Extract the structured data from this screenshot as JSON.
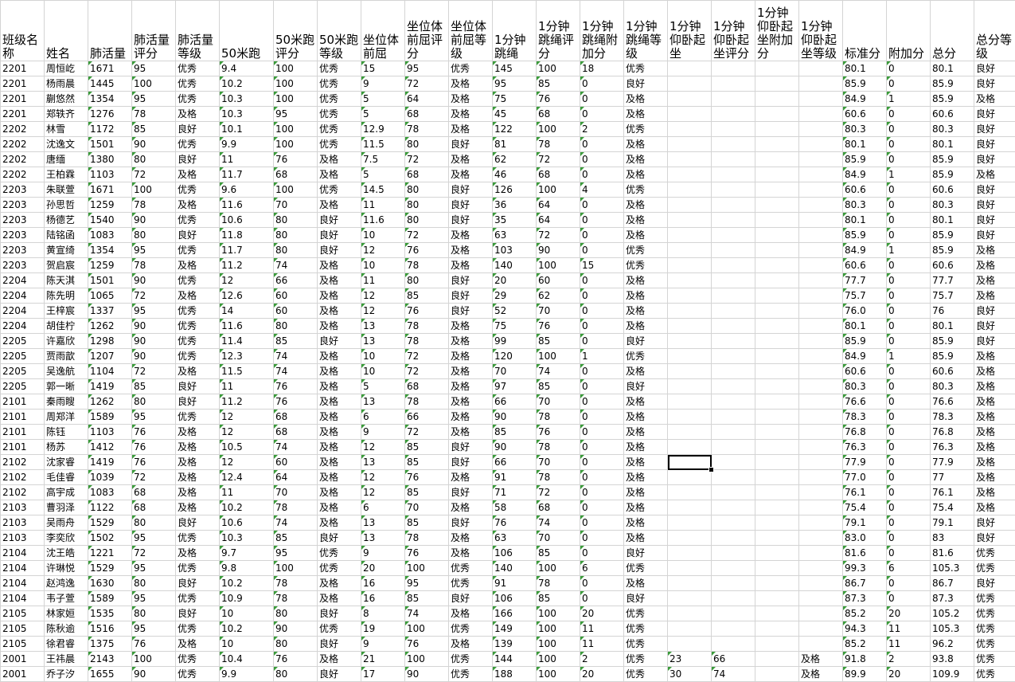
{
  "headers": [
    "班级名称",
    "姓名",
    "肺活量",
    "肺活量评分",
    "肺活量等级",
    "50米跑",
    "50米跑评分",
    "50米跑等级",
    "坐位体前屈",
    "坐位体前屈评分",
    "坐位体前屈等级",
    "1分钟跳绳",
    "1分钟跳绳评分",
    "1分钟跳绳附加分",
    "1分钟跳绳等级",
    "1分钟仰卧起坐",
    "1分钟仰卧起坐评分",
    "1分钟仰卧起坐附加分",
    "1分钟仰卧起坐等级",
    "标准分",
    "附加分",
    "总分",
    "总分等级"
  ],
  "rows": [
    [
      "2201",
      "周恒屹",
      "1671",
      "95",
      "优秀",
      "9.4",
      "100",
      "优秀",
      "15",
      "95",
      "优秀",
      "145",
      "100",
      "18",
      "优秀",
      "",
      "",
      "",
      "",
      "80.1",
      "0",
      "80.1",
      "良好"
    ],
    [
      "2201",
      "杨雨晨",
      "1445",
      "100",
      "优秀",
      "10.2",
      "100",
      "优秀",
      "9",
      "72",
      "及格",
      "95",
      "85",
      "0",
      "良好",
      "",
      "",
      "",
      "",
      "85.9",
      "0",
      "85.9",
      "良好"
    ],
    [
      "2201",
      "蒯悠然",
      "1354",
      "95",
      "优秀",
      "10.3",
      "100",
      "优秀",
      "5",
      "64",
      "及格",
      "75",
      "76",
      "0",
      "及格",
      "",
      "",
      "",
      "",
      "84.9",
      "1",
      "85.9",
      "及格"
    ],
    [
      "2201",
      "郑轶齐",
      "1276",
      "78",
      "及格",
      "10.3",
      "95",
      "优秀",
      "5",
      "68",
      "及格",
      "45",
      "68",
      "0",
      "及格",
      "",
      "",
      "",
      "",
      "60.6",
      "0",
      "60.6",
      "良好"
    ],
    [
      "2202",
      "林雪",
      "1172",
      "85",
      "良好",
      "10.1",
      "100",
      "优秀",
      "12.9",
      "78",
      "及格",
      "122",
      "100",
      "2",
      "优秀",
      "",
      "",
      "",
      "",
      "80.3",
      "0",
      "80.3",
      "良好"
    ],
    [
      "2202",
      "沈逸文",
      "1501",
      "90",
      "优秀",
      "9.9",
      "100",
      "优秀",
      "11.5",
      "80",
      "良好",
      "81",
      "78",
      "0",
      "及格",
      "",
      "",
      "",
      "",
      "80.1",
      "0",
      "80.1",
      "良好"
    ],
    [
      "2202",
      "唐缅",
      "1380",
      "80",
      "良好",
      "11",
      "76",
      "及格",
      "7.5",
      "72",
      "及格",
      "62",
      "72",
      "0",
      "及格",
      "",
      "",
      "",
      "",
      "85.9",
      "0",
      "85.9",
      "良好"
    ],
    [
      "2202",
      "王柏霖",
      "1103",
      "72",
      "及格",
      "11.7",
      "68",
      "及格",
      "5",
      "68",
      "及格",
      "46",
      "68",
      "0",
      "及格",
      "",
      "",
      "",
      "",
      "84.9",
      "1",
      "85.9",
      "及格"
    ],
    [
      "2203",
      "朱联萱",
      "1671",
      "100",
      "优秀",
      "9.6",
      "100",
      "优秀",
      "14.5",
      "80",
      "良好",
      "126",
      "100",
      "4",
      "优秀",
      "",
      "",
      "",
      "",
      "60.6",
      "0",
      "60.6",
      "良好"
    ],
    [
      "2203",
      "孙思哲",
      "1259",
      "78",
      "及格",
      "11.6",
      "70",
      "及格",
      "11",
      "80",
      "良好",
      "36",
      "64",
      "0",
      "及格",
      "",
      "",
      "",
      "",
      "80.3",
      "0",
      "80.3",
      "良好"
    ],
    [
      "2203",
      "杨德艺",
      "1540",
      "90",
      "优秀",
      "10.6",
      "80",
      "良好",
      "11.6",
      "80",
      "良好",
      "35",
      "64",
      "0",
      "及格",
      "",
      "",
      "",
      "",
      "80.1",
      "0",
      "80.1",
      "良好"
    ],
    [
      "2203",
      "陆铭函",
      "1083",
      "80",
      "良好",
      "11.8",
      "80",
      "良好",
      "10",
      "72",
      "及格",
      "63",
      "72",
      "0",
      "及格",
      "",
      "",
      "",
      "",
      "85.9",
      "0",
      "85.9",
      "良好"
    ],
    [
      "2203",
      "黄宣绮",
      "1354",
      "95",
      "优秀",
      "11.7",
      "80",
      "良好",
      "12",
      "76",
      "及格",
      "103",
      "90",
      "0",
      "优秀",
      "",
      "",
      "",
      "",
      "84.9",
      "1",
      "85.9",
      "及格"
    ],
    [
      "2203",
      "贺启宸",
      "1259",
      "78",
      "及格",
      "11.2",
      "74",
      "及格",
      "10",
      "78",
      "及格",
      "140",
      "100",
      "15",
      "优秀",
      "",
      "",
      "",
      "",
      "60.6",
      "0",
      "60.6",
      "及格"
    ],
    [
      "2204",
      "陈天淇",
      "1501",
      "90",
      "优秀",
      "12",
      "66",
      "及格",
      "11",
      "80",
      "良好",
      "20",
      "60",
      "0",
      "及格",
      "",
      "",
      "",
      "",
      "77.7",
      "0",
      "77.7",
      "及格"
    ],
    [
      "2204",
      "陈先明",
      "1065",
      "72",
      "及格",
      "12.6",
      "60",
      "及格",
      "12",
      "85",
      "良好",
      "29",
      "62",
      "0",
      "及格",
      "",
      "",
      "",
      "",
      "75.7",
      "0",
      "75.7",
      "及格"
    ],
    [
      "2204",
      "王梓宸",
      "1337",
      "95",
      "优秀",
      "14",
      "60",
      "及格",
      "12",
      "76",
      "良好",
      "52",
      "70",
      "0",
      "及格",
      "",
      "",
      "",
      "",
      "76.0",
      "0",
      "76",
      "良好"
    ],
    [
      "2204",
      "胡佳柠",
      "1262",
      "90",
      "优秀",
      "11.6",
      "80",
      "及格",
      "13",
      "78",
      "及格",
      "75",
      "76",
      "0",
      "及格",
      "",
      "",
      "",
      "",
      "80.1",
      "0",
      "80.1",
      "良好"
    ],
    [
      "2205",
      "许嘉欣",
      "1298",
      "90",
      "优秀",
      "11.4",
      "85",
      "良好",
      "13",
      "78",
      "及格",
      "99",
      "85",
      "0",
      "良好",
      "",
      "",
      "",
      "",
      "85.9",
      "0",
      "85.9",
      "良好"
    ],
    [
      "2205",
      "贾雨歆",
      "1207",
      "90",
      "优秀",
      "12.3",
      "74",
      "及格",
      "10",
      "72",
      "及格",
      "120",
      "100",
      "1",
      "优秀",
      "",
      "",
      "",
      "",
      "84.9",
      "1",
      "85.9",
      "及格"
    ],
    [
      "2205",
      "吴逸航",
      "1104",
      "72",
      "及格",
      "11.5",
      "74",
      "及格",
      "10",
      "72",
      "及格",
      "70",
      "74",
      "0",
      "及格",
      "",
      "",
      "",
      "",
      "60.6",
      "0",
      "60.6",
      "及格"
    ],
    [
      "2205",
      "郭一晰",
      "1419",
      "85",
      "良好",
      "11",
      "76",
      "及格",
      "5",
      "68",
      "及格",
      "97",
      "85",
      "0",
      "良好",
      "",
      "",
      "",
      "",
      "80.3",
      "0",
      "80.3",
      "及格"
    ],
    [
      "2101",
      "秦雨瞍",
      "1262",
      "80",
      "良好",
      "11.2",
      "76",
      "及格",
      "13",
      "78",
      "及格",
      "66",
      "70",
      "0",
      "及格",
      "",
      "",
      "",
      "",
      "76.6",
      "0",
      "76.6",
      "及格"
    ],
    [
      "2101",
      "周郑洋",
      "1589",
      "95",
      "优秀",
      "12",
      "68",
      "及格",
      "6",
      "66",
      "及格",
      "90",
      "78",
      "0",
      "及格",
      "",
      "",
      "",
      "",
      "78.3",
      "0",
      "78.3",
      "及格"
    ],
    [
      "2101",
      "陈钰",
      "1103",
      "76",
      "及格",
      "12",
      "68",
      "及格",
      "9",
      "72",
      "及格",
      "85",
      "76",
      "0",
      "及格",
      "",
      "",
      "",
      "",
      "76.8",
      "0",
      "76.8",
      "及格"
    ],
    [
      "2101",
      "杨苏",
      "1412",
      "76",
      "及格",
      "10.5",
      "74",
      "及格",
      "12",
      "85",
      "良好",
      "90",
      "78",
      "0",
      "及格",
      "",
      "",
      "",
      "",
      "76.3",
      "0",
      "76.3",
      "及格"
    ],
    [
      "2102",
      "沈家睿",
      "1419",
      "76",
      "及格",
      "12",
      "60",
      "及格",
      "13",
      "85",
      "良好",
      "66",
      "70",
      "0",
      "及格",
      "",
      "",
      "",
      "",
      "77.9",
      "0",
      "77.9",
      "及格"
    ],
    [
      "2102",
      "毛佳睿",
      "1039",
      "72",
      "及格",
      "12.4",
      "64",
      "及格",
      "12",
      "76",
      "及格",
      "91",
      "78",
      "0",
      "及格",
      "",
      "",
      "",
      "",
      "77.0",
      "0",
      "77",
      "及格"
    ],
    [
      "2102",
      "高宇成",
      "1083",
      "68",
      "及格",
      "11",
      "70",
      "及格",
      "12",
      "85",
      "良好",
      "71",
      "72",
      "0",
      "及格",
      "",
      "",
      "",
      "",
      "76.1",
      "0",
      "76.1",
      "及格"
    ],
    [
      "2103",
      "曹羽泽",
      "1122",
      "68",
      "及格",
      "10.2",
      "78",
      "及格",
      "6",
      "70",
      "及格",
      "58",
      "68",
      "0",
      "及格",
      "",
      "",
      "",
      "",
      "75.4",
      "0",
      "75.4",
      "及格"
    ],
    [
      "2103",
      "吴雨舟",
      "1529",
      "80",
      "良好",
      "10.6",
      "74",
      "及格",
      "13",
      "85",
      "良好",
      "76",
      "74",
      "0",
      "及格",
      "",
      "",
      "",
      "",
      "79.1",
      "0",
      "79.1",
      "良好"
    ],
    [
      "2103",
      "李奕欣",
      "1502",
      "95",
      "优秀",
      "10.3",
      "85",
      "良好",
      "13",
      "78",
      "及格",
      "63",
      "70",
      "0",
      "及格",
      "",
      "",
      "",
      "",
      "83.0",
      "0",
      "83",
      "良好"
    ],
    [
      "2104",
      "沈王皓",
      "1221",
      "72",
      "及格",
      "9.7",
      "95",
      "优秀",
      "9",
      "76",
      "及格",
      "106",
      "85",
      "0",
      "良好",
      "",
      "",
      "",
      "",
      "81.6",
      "0",
      "81.6",
      "优秀"
    ],
    [
      "2104",
      "许琳悦",
      "1529",
      "95",
      "优秀",
      "9.8",
      "100",
      "优秀",
      "20",
      "100",
      "优秀",
      "140",
      "100",
      "6",
      "优秀",
      "",
      "",
      "",
      "",
      "99.3",
      "6",
      "105.3",
      "优秀"
    ],
    [
      "2104",
      "赵鸿逸",
      "1630",
      "80",
      "良好",
      "10.2",
      "78",
      "及格",
      "16",
      "95",
      "优秀",
      "91",
      "78",
      "0",
      "及格",
      "",
      "",
      "",
      "",
      "86.7",
      "0",
      "86.7",
      "良好"
    ],
    [
      "2104",
      "韦子萱",
      "1589",
      "95",
      "优秀",
      "10.9",
      "78",
      "及格",
      "16",
      "85",
      "良好",
      "106",
      "85",
      "0",
      "良好",
      "",
      "",
      "",
      "",
      "87.3",
      "0",
      "87.3",
      "优秀"
    ],
    [
      "2105",
      "林家姮",
      "1535",
      "80",
      "良好",
      "10",
      "80",
      "良好",
      "8",
      "74",
      "及格",
      "166",
      "100",
      "20",
      "优秀",
      "",
      "",
      "",
      "",
      "85.2",
      "20",
      "105.2",
      "优秀"
    ],
    [
      "2105",
      "陈秋逾",
      "1516",
      "95",
      "优秀",
      "10.2",
      "90",
      "优秀",
      "19",
      "100",
      "优秀",
      "149",
      "100",
      "11",
      "优秀",
      "",
      "",
      "",
      "",
      "94.3",
      "11",
      "105.3",
      "优秀"
    ],
    [
      "2105",
      "徐君睿",
      "1375",
      "76",
      "及格",
      "10",
      "80",
      "良好",
      "9",
      "76",
      "及格",
      "139",
      "100",
      "11",
      "优秀",
      "",
      "",
      "",
      "",
      "85.2",
      "11",
      "96.2",
      "优秀"
    ],
    [
      "2001",
      "王祎晨",
      "2143",
      "100",
      "优秀",
      "10.4",
      "76",
      "及格",
      "21",
      "100",
      "优秀",
      "144",
      "100",
      "2",
      "优秀",
      "23",
      "66",
      "",
      "及格",
      "91.8",
      "2",
      "93.8",
      "优秀"
    ],
    [
      "2001",
      "乔子汐",
      "1655",
      "90",
      "优秀",
      "9.9",
      "80",
      "良好",
      "17",
      "90",
      "优秀",
      "188",
      "100",
      "20",
      "优秀",
      "30",
      "74",
      "",
      "及格",
      "89.9",
      "20",
      "109.9",
      "优秀"
    ]
  ]
}
